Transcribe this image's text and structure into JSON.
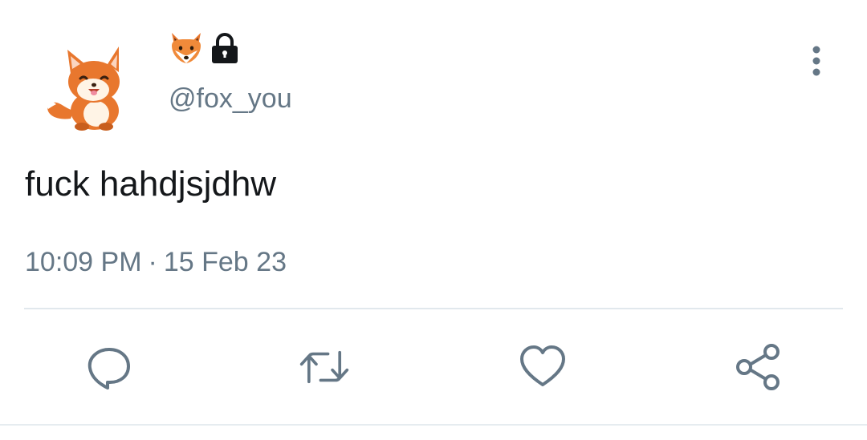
{
  "author": {
    "display_name_icons": [
      "fox-emoji",
      "lock-icon"
    ],
    "handle": "@fox_you",
    "avatar_icon": "fox-avatar"
  },
  "tweet": {
    "text": "fuck hahdjsjdhw",
    "time": "10:09 PM",
    "separator": "·",
    "date": "15 Feb 23"
  },
  "actions": [
    "reply-icon",
    "retweet-icon",
    "like-icon",
    "share-icon"
  ],
  "colors": {
    "secondary_text": "#657786",
    "primary_text": "#14171a",
    "divider": "#e1e8ed",
    "fox_orange": "#e8772e"
  }
}
